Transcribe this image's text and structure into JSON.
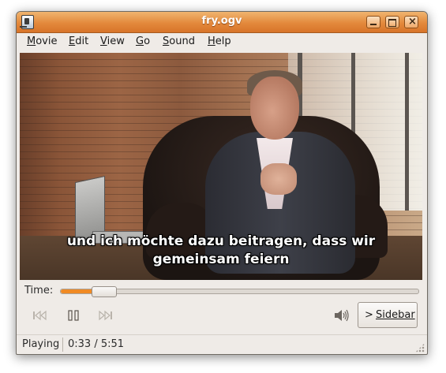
{
  "window": {
    "title": "fry.ogv",
    "accent": "#e3893c"
  },
  "menubar": {
    "items": [
      {
        "pre": "",
        "ul": "M",
        "post": "ovie"
      },
      {
        "pre": "",
        "ul": "E",
        "post": "dit"
      },
      {
        "pre": "",
        "ul": "V",
        "post": "iew"
      },
      {
        "pre": "",
        "ul": "G",
        "post": "o"
      },
      {
        "pre": "",
        "ul": "S",
        "post": "ound"
      },
      {
        "pre": "",
        "ul": "H",
        "post": "elp"
      }
    ]
  },
  "video": {
    "subtitle_line1": "und ich möchte dazu beitragen, dass wir",
    "subtitle_line2": "gemeinsam feiern"
  },
  "seek": {
    "label": "Time:",
    "progress": 0.096,
    "fill_color": "#f08a24"
  },
  "controls": {
    "prev_icon": "skip-backward-icon",
    "pause_icon": "pause-icon",
    "next_icon": "skip-forward-icon",
    "volume_icon": "speaker-volume-icon",
    "sidebar_chevron": ">",
    "sidebar_label": "Sidebar"
  },
  "status": {
    "state": "Playing",
    "time": "0:33 / 5:51"
  }
}
